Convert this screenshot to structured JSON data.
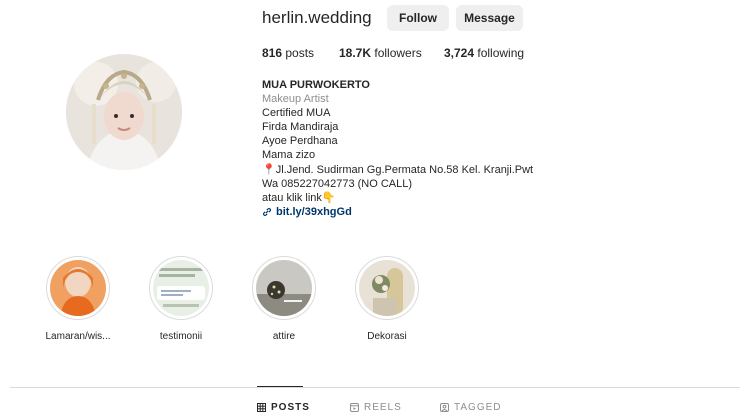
{
  "profile": {
    "username": "herlin.wedding",
    "follow_label": "Follow",
    "message_label": "Message",
    "stats": {
      "posts_count": "816",
      "posts_label": "posts",
      "followers_count": "18.7K",
      "followers_label": "followers",
      "following_count": "3,724",
      "following_label": "following"
    },
    "bio": {
      "name": "MUA PURWOKERTO",
      "category": "Makeup Artist",
      "lines": [
        "Certified MUA",
        "Firda Mandiraja",
        "Ayoe Perdhana",
        "Mama zizo",
        "📍Jl.Jend. Sudirman Gg.Permata No.58 Kel. Kranji.Pwt",
        "Wa 085227042773 (NO CALL)",
        "atau klik link👇"
      ],
      "link": "bit.ly/39xhgGd"
    }
  },
  "highlights": [
    {
      "label": "Lamaran/wis..."
    },
    {
      "label": "testimonii"
    },
    {
      "label": "attire"
    },
    {
      "label": "Dekorasi"
    }
  ],
  "tabs": {
    "posts": "POSTS",
    "reels": "REELS",
    "tagged": "TAGGED"
  },
  "colors": {
    "text": "#262626",
    "muted": "#8e8e8e",
    "link": "#00376b",
    "button_bg": "#efefef",
    "divider": "#dbdbdb"
  },
  "icons": {
    "link": "link-icon",
    "posts": "grid-icon",
    "reels": "reels-icon",
    "tagged": "tagged-icon"
  }
}
